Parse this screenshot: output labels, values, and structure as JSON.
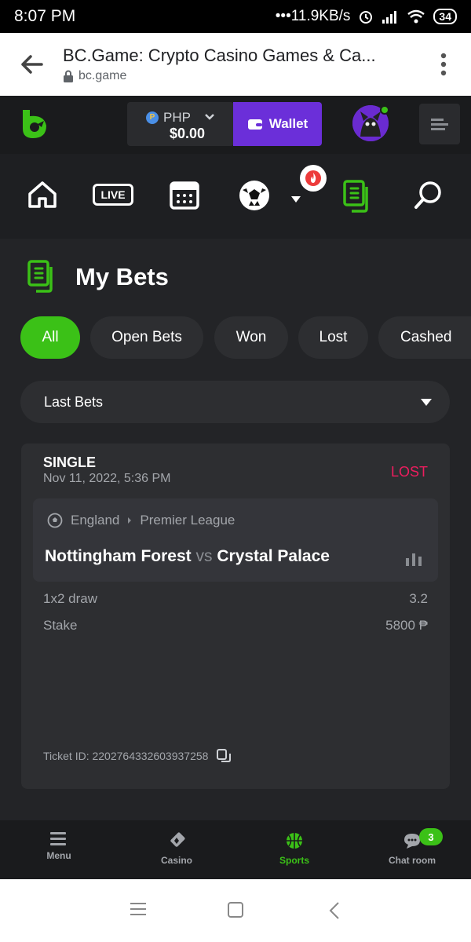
{
  "status_bar": {
    "time": "8:07 PM",
    "network_speed": "•••11.9KB/s",
    "battery": "34"
  },
  "browser": {
    "title": "BC.Game: Crypto Casino Games & Ca...",
    "url": "bc.game"
  },
  "header": {
    "currency": "PHP",
    "balance": "$0.00",
    "wallet_label": "Wallet"
  },
  "nav": {
    "live_label": "LIVE"
  },
  "page": {
    "title": "My Bets"
  },
  "tabs": [
    {
      "label": "All"
    },
    {
      "label": "Open Bets"
    },
    {
      "label": "Won"
    },
    {
      "label": "Lost"
    },
    {
      "label": "Cashed"
    }
  ],
  "filter": {
    "selected": "Last Bets"
  },
  "bet": {
    "type": "SINGLE",
    "date": "Nov 11, 2022, 5:36 PM",
    "status": "LOST",
    "country": "England",
    "league": "Premier League",
    "home_team": "Nottingham Forest",
    "vs": "vs",
    "away_team": "Crystal Palace",
    "market_label": "1x2 draw",
    "odds": "3.2",
    "stake_label": "Stake",
    "stake_value": "5800 ₱",
    "ticket_id": "Ticket ID: 2202764332603937258"
  },
  "bottom_nav": [
    {
      "label": "Menu"
    },
    {
      "label": "Casino"
    },
    {
      "label": "Sports"
    },
    {
      "label": "Chat room"
    }
  ],
  "chat_badge": "3",
  "colors": {
    "accent": "#3bc117",
    "wallet": "#6b2fd9",
    "lost": "#ed1d5e",
    "card": "#2d2e31"
  }
}
